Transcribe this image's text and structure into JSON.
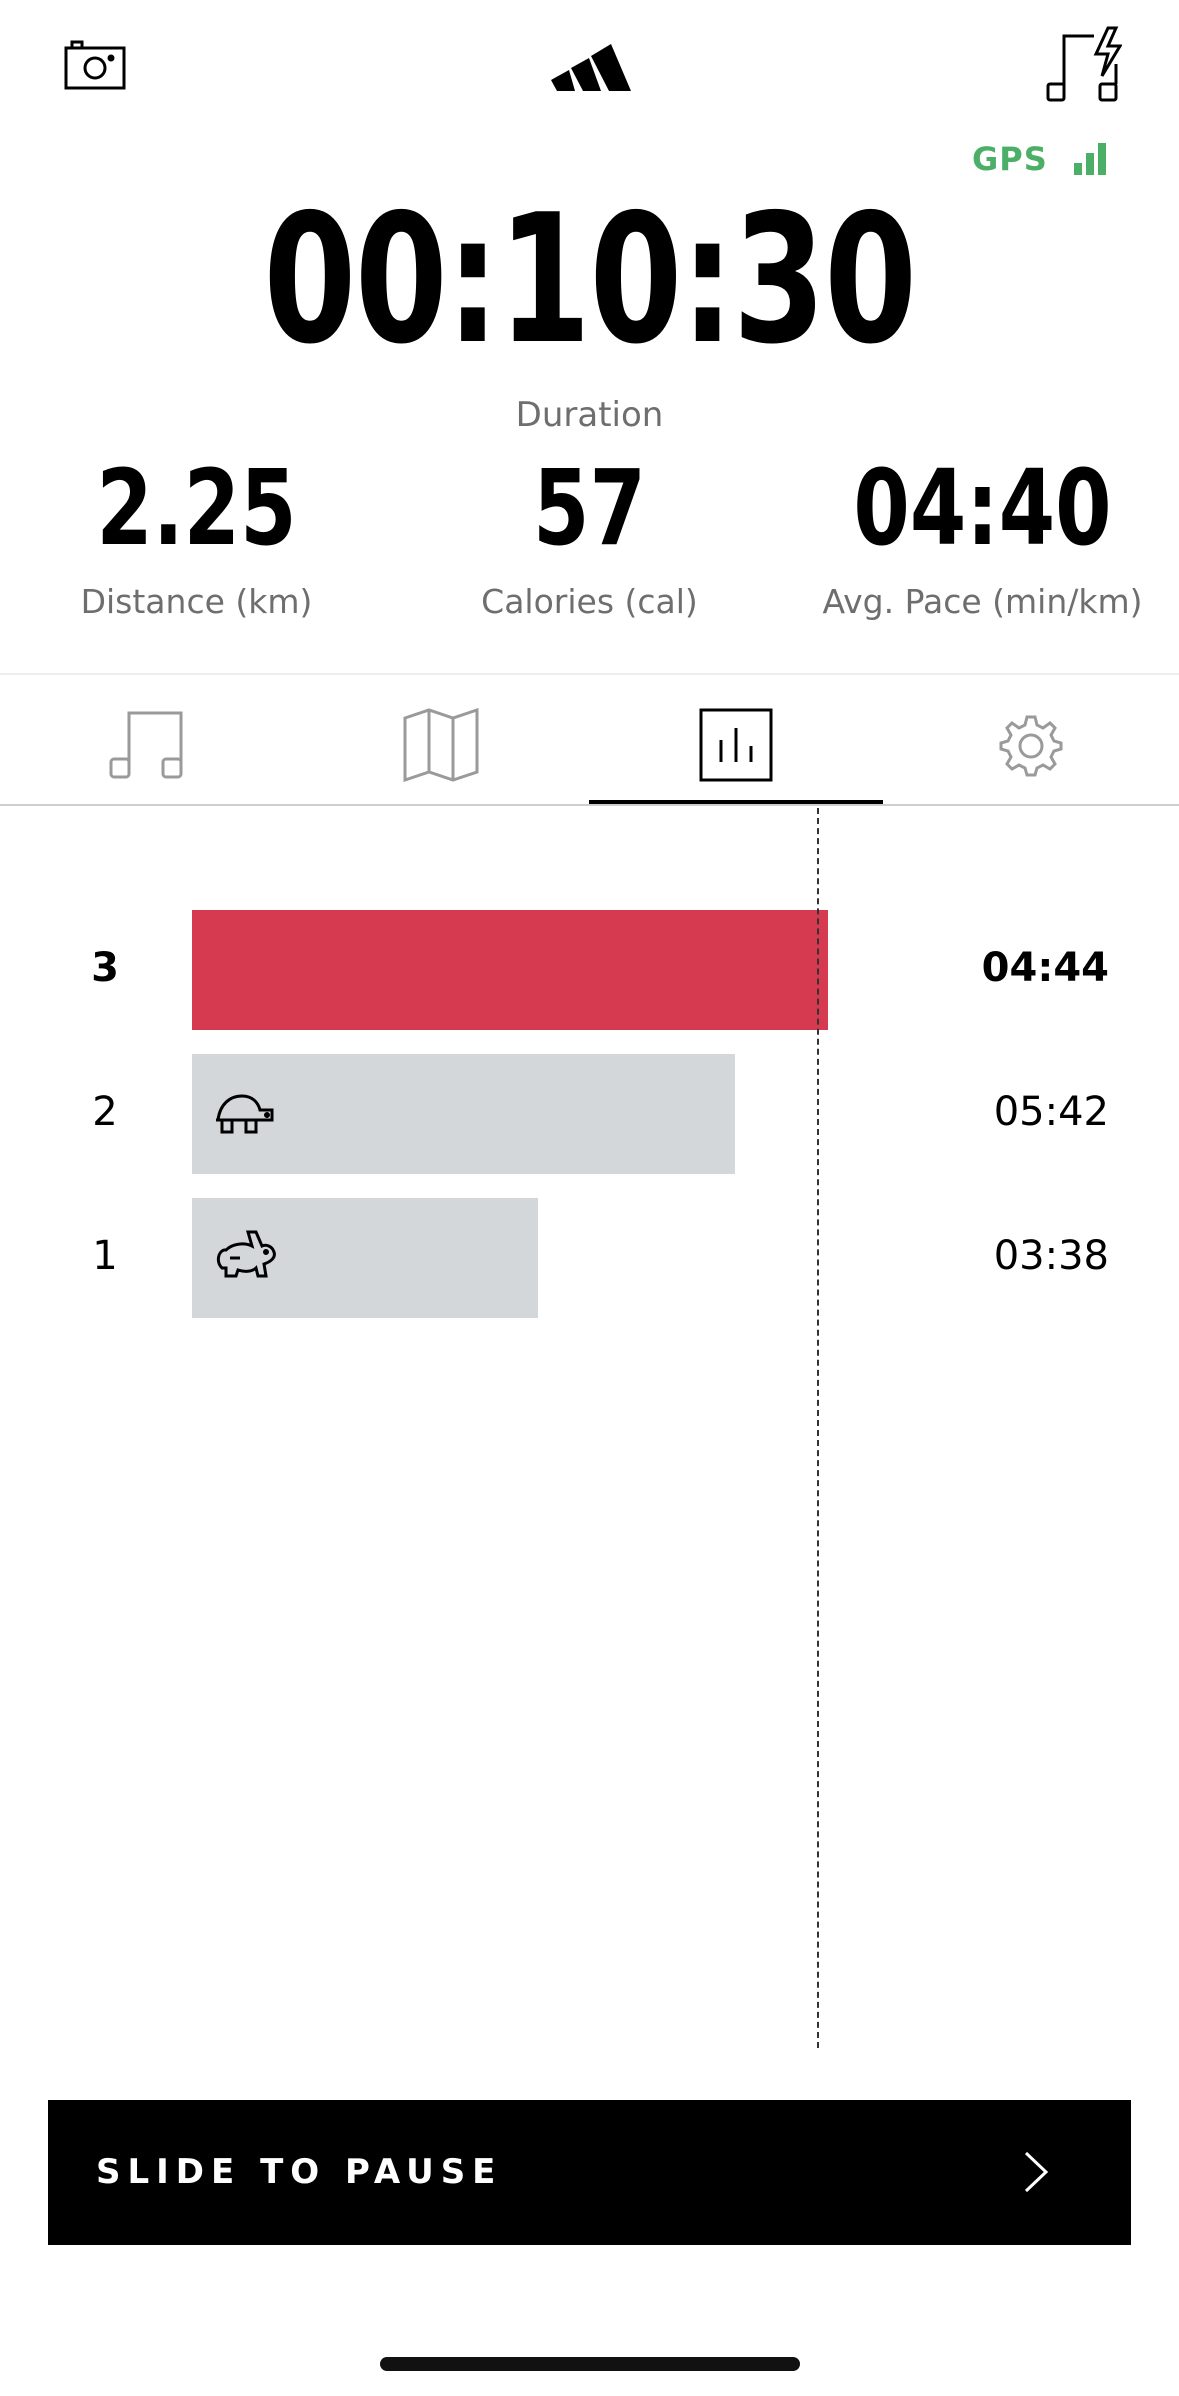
{
  "header": {
    "camera_icon": "camera-icon",
    "logo_icon": "adidas-logo",
    "music_flash_icon": "music-flash-icon"
  },
  "gps": {
    "label": "GPS",
    "color": "#4caf67"
  },
  "timer": {
    "value": "00:10:30",
    "label": "Duration"
  },
  "metrics": [
    {
      "value": "2.25",
      "label": "Distance (km)"
    },
    {
      "value": "57",
      "label": "Calories (cal)"
    },
    {
      "value": "04:40",
      "label": "Avg. Pace (min/km)"
    }
  ],
  "tabs": [
    {
      "icon": "music-icon",
      "active": false
    },
    {
      "icon": "map-icon",
      "active": false
    },
    {
      "icon": "chart-icon",
      "active": true
    },
    {
      "icon": "settings-icon",
      "active": false
    }
  ],
  "laps": [
    {
      "number": "3",
      "time": "04:44",
      "current": true,
      "icon": "",
      "color": "#d63a50"
    },
    {
      "number": "2",
      "time": "05:42",
      "current": false,
      "icon": "turtle-icon",
      "color": "#d4d7d9"
    },
    {
      "number": "1",
      "time": "03:38",
      "current": false,
      "icon": "rabbit-icon",
      "color": "#d4d7d9"
    }
  ],
  "slide": {
    "label": "SLIDE TO PAUSE"
  }
}
